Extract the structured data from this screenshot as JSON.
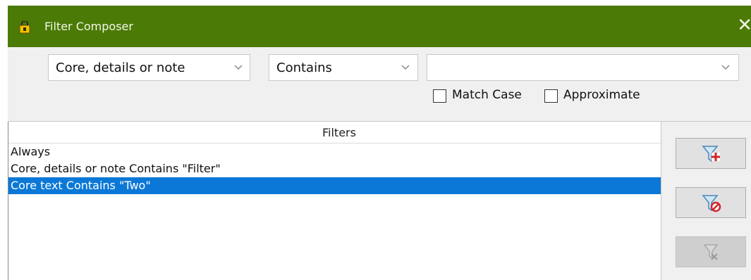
{
  "window": {
    "title": "Filter Composer",
    "close_glyph": "✕"
  },
  "field_combo": {
    "value": "Core, details or note"
  },
  "condition_combo": {
    "value": "Contains"
  },
  "value_combo": {
    "value": ""
  },
  "options": {
    "match_case_label": "Match Case",
    "match_case_checked": false,
    "approximate_label": "Approximate",
    "approximate_checked": false
  },
  "filters": {
    "header": "Filters",
    "rows": [
      {
        "text": "Always",
        "selected": false
      },
      {
        "text": "Core, details or note Contains \"Filter\"",
        "selected": false
      },
      {
        "text": "Core text Contains \"Two\"",
        "selected": true
      }
    ]
  },
  "side_buttons": [
    {
      "icon": "filter-add-icon",
      "enabled": true
    },
    {
      "icon": "filter-delete-icon",
      "enabled": true
    },
    {
      "icon": "filter-edit-icon",
      "enabled": false
    }
  ],
  "colors": {
    "titlebar": "#4b7a06",
    "selection": "#0b78d7"
  }
}
